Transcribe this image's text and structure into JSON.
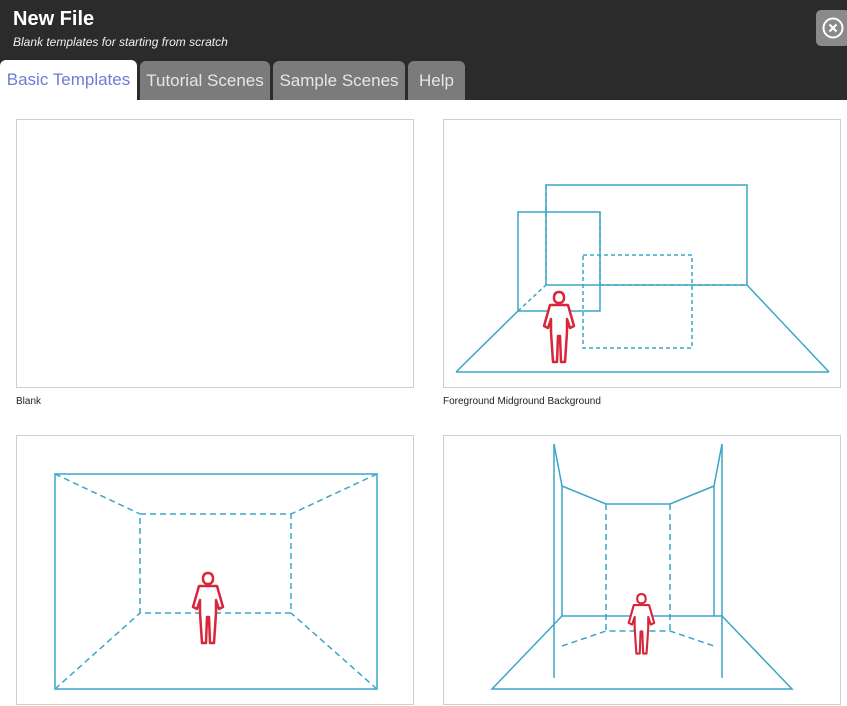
{
  "header": {
    "title": "New File",
    "subtitle": "Blank templates for starting from scratch"
  },
  "tabs": [
    {
      "label": "Basic Templates",
      "active": true
    },
    {
      "label": "Tutorial Scenes",
      "active": false
    },
    {
      "label": "Sample Scenes",
      "active": false
    },
    {
      "label": "Help",
      "active": false
    }
  ],
  "templates": [
    {
      "label": "Blank",
      "preview": "empty"
    },
    {
      "label": "Foreground Midground Background",
      "preview": "layered-planes"
    },
    {
      "label": "",
      "preview": "room-one-point-perspective"
    },
    {
      "label": "",
      "preview": "corridor-perspective"
    }
  ],
  "icons": {
    "close": "close-circle-icon",
    "figure": "human-figure-icon"
  },
  "colors": {
    "header_bg": "#2b2b2b",
    "tab_inactive": "#7b7b7b",
    "tab_active_text": "#6f7bd6",
    "line": "#3aa6c6",
    "figure": "#d8263a"
  }
}
